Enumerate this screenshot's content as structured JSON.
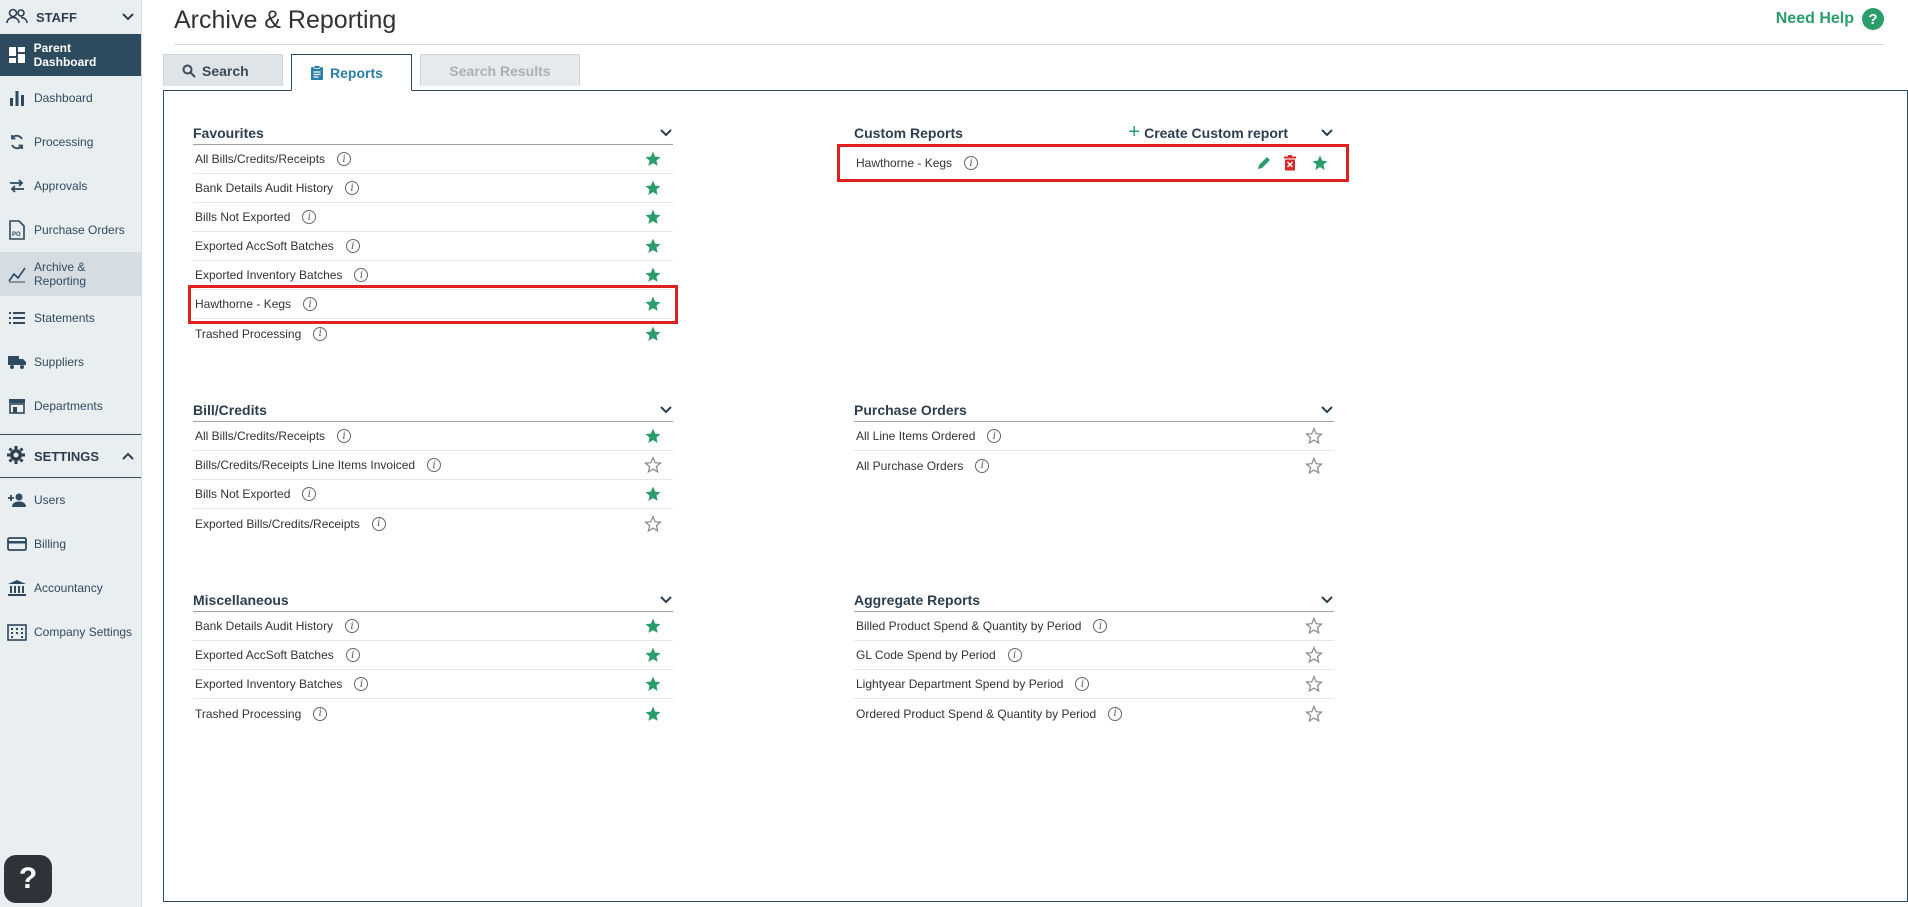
{
  "sidebar": {
    "staff_label": "STAFF",
    "settings_label": "SETTINGS",
    "items": [
      {
        "label": "Parent Dashboard",
        "icon": "grid-icon"
      },
      {
        "label": "Dashboard",
        "icon": "bar-chart-icon"
      },
      {
        "label": "Processing",
        "icon": "sync-icon"
      },
      {
        "label": "Approvals",
        "icon": "swap-icon"
      },
      {
        "label": "Purchase Orders",
        "icon": "po-document-icon"
      },
      {
        "label": "Archive & Reporting",
        "icon": "line-chart-icon"
      },
      {
        "label": "Statements",
        "icon": "list-icon"
      },
      {
        "label": "Suppliers",
        "icon": "truck-icon"
      },
      {
        "label": "Departments",
        "icon": "store-icon"
      }
    ],
    "settings_items": [
      {
        "label": "Users",
        "icon": "add-user-icon"
      },
      {
        "label": "Billing",
        "icon": "credit-card-icon"
      },
      {
        "label": "Accountancy",
        "icon": "bank-icon"
      },
      {
        "label": "Company Settings",
        "icon": "building-icon"
      }
    ],
    "help_glyph": "?"
  },
  "header": {
    "title": "Archive & Reporting",
    "need_help": "Need Help",
    "help_glyph": "?"
  },
  "tabs": [
    {
      "label": "Search"
    },
    {
      "label": "Reports"
    },
    {
      "label": "Search Results"
    }
  ],
  "colors": {
    "accent": "#2a9d6a",
    "navy": "#2d4a5e",
    "highlight": "#e01f1f"
  },
  "sections": {
    "favourites": {
      "title": "Favourites",
      "rows": [
        {
          "name": "All Bills/Credits/Receipts",
          "fav": true
        },
        {
          "name": "Bank Details Audit History",
          "fav": true
        },
        {
          "name": "Bills Not Exported",
          "fav": true
        },
        {
          "name": "Exported AccSoft Batches",
          "fav": true
        },
        {
          "name": "Exported Inventory Batches",
          "fav": true
        },
        {
          "name": "Hawthorne - Kegs",
          "fav": true
        },
        {
          "name": "Trashed Processing",
          "fav": true
        }
      ]
    },
    "custom": {
      "title": "Custom Reports",
      "create_label": "Create Custom report",
      "rows": [
        {
          "name": "Hawthorne - Kegs",
          "fav": true
        }
      ]
    },
    "bills": {
      "title": "Bill/Credits",
      "rows": [
        {
          "name": "All Bills/Credits/Receipts",
          "fav": true
        },
        {
          "name": "Bills/Credits/Receipts Line Items Invoiced",
          "fav": false
        },
        {
          "name": "Bills Not Exported",
          "fav": true
        },
        {
          "name": "Exported Bills/Credits/Receipts",
          "fav": false
        }
      ]
    },
    "purchase_orders": {
      "title": "Purchase Orders",
      "rows": [
        {
          "name": "All Line Items Ordered",
          "fav": false
        },
        {
          "name": "All Purchase Orders",
          "fav": false
        }
      ]
    },
    "misc": {
      "title": "Miscellaneous",
      "rows": [
        {
          "name": "Bank Details Audit History",
          "fav": true
        },
        {
          "name": "Exported AccSoft Batches",
          "fav": true
        },
        {
          "name": "Exported Inventory Batches",
          "fav": true
        },
        {
          "name": "Trashed Processing",
          "fav": true
        }
      ]
    },
    "aggregate": {
      "title": "Aggregate Reports",
      "rows": [
        {
          "name": "Billed Product Spend & Quantity by Period",
          "fav": false
        },
        {
          "name": "GL Code Spend by Period",
          "fav": false
        },
        {
          "name": "Lightyear Department Spend by Period",
          "fav": false
        },
        {
          "name": "Ordered Product Spend & Quantity by Period",
          "fav": false
        }
      ]
    }
  }
}
